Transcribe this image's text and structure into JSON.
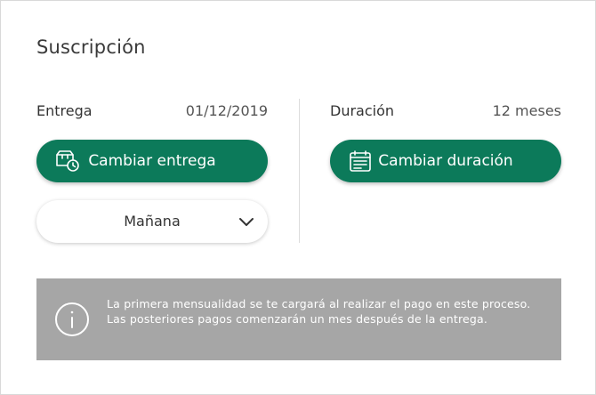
{
  "title": "Suscripción",
  "delivery": {
    "label": "Entrega",
    "date": "01/12/2019",
    "change_button": "Cambiar entrega",
    "icon": "delivery-truck-clock-icon",
    "time_select": {
      "selected": "Mañana"
    }
  },
  "duration": {
    "label": "Duración",
    "value": "12 meses",
    "change_button": "Cambiar duración",
    "icon": "calendar-icon"
  },
  "info": {
    "icon": "info-icon",
    "text": "La primera mensualidad se te cargará al realizar el pago en este proceso. Las posteriores pagos comenzarán un mes después de la entrega."
  },
  "colors": {
    "primary": "#0c7a5a",
    "info_background": "#a6a6a6"
  }
}
